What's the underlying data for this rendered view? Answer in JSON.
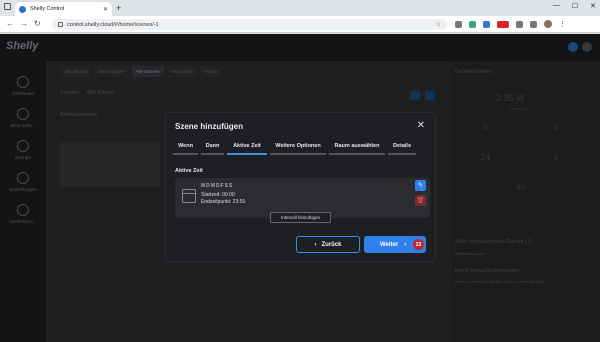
{
  "browser": {
    "tab_title": "Shelly Control",
    "url": "control.shelly.cloud/#/home/scenes/-1"
  },
  "app": {
    "sidebar": [
      {
        "label": "Dashboard"
      },
      {
        "label": "Mein Zuha..."
      },
      {
        "label": "Energie"
      },
      {
        "label": "Einstellungen"
      },
      {
        "label": "Gerät hinzu..."
      }
    ],
    "main_tabs": [
      "Alle Räume",
      "Alle Gruppen",
      "Alle Szenen",
      "Alle Geräte",
      "Alarme"
    ],
    "scenes_bar": [
      "Szenen",
      "Alle Räume"
    ],
    "card_label": "Briefkastenalarm",
    "right_panel": {
      "title": "Gerätestatistiken",
      "power": "2.35 W",
      "power_caption": "Verbrauch",
      "stats": [
        "0",
        "0",
        "24",
        "0",
        "40"
      ],
      "top_title": "Aktiv verbrauchende Geräte (1)",
      "top_item": "Briefkastenalarm",
      "notif_title": "Keine Benachrichtigungen.",
      "notif_text": "Wenn es etwas Neues gibt, wird es hier angezeigt."
    }
  },
  "modal": {
    "title": "Szene hinzufügen",
    "steps": [
      "Wenn",
      "Dann",
      "Aktive Zeit",
      "Weitere Optionen",
      "Raum auswählen",
      "Details"
    ],
    "active_step_index": 2,
    "section_label": "Aktive Zeit",
    "days": "MDMDFSS",
    "start": "Startzeit: 00:00",
    "end": "Endzeitpunkt: 23:59",
    "add_interval": "Intervall hinzufügen",
    "back_label": "Zurück",
    "next_label": "Weiter",
    "badge": "22"
  },
  "colors": {
    "accent": "#2f80ed",
    "delete": "#7b2a2e",
    "badge": "#c0262b"
  }
}
